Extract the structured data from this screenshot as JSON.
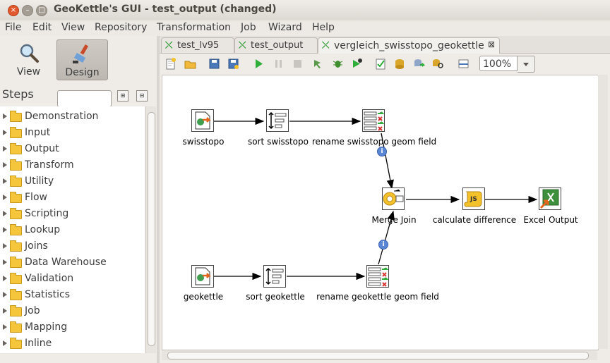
{
  "window": {
    "title": "GeoKettle's GUI - test_output (changed)",
    "controls": [
      "close",
      "minimize",
      "maximize"
    ]
  },
  "menu": [
    "File",
    "Edit",
    "View",
    "Repository",
    "Transformation",
    "Job",
    "Wizard",
    "Help"
  ],
  "perspectives": [
    {
      "label": "View",
      "icon": "magnifier-icon",
      "active": false
    },
    {
      "label": "Design",
      "icon": "paintbrush-icon",
      "active": true
    }
  ],
  "steps_panel": {
    "title": "Steps",
    "search_placeholder": "",
    "items": [
      "Demonstration",
      "Input",
      "Output",
      "Transform",
      "Utility",
      "Flow",
      "Scripting",
      "Lookup",
      "Joins",
      "Data Warehouse",
      "Validation",
      "Statistics",
      "Job",
      "Mapping",
      "Inline"
    ]
  },
  "tabs": [
    {
      "label": "test_lv95",
      "active": false
    },
    {
      "label": "test_output",
      "active": false
    },
    {
      "label": "vergleich_swisstopo_geokettle",
      "active": true,
      "closable": true
    }
  ],
  "toolbar": {
    "zoom": "100%",
    "icons": [
      "new-icon",
      "open-icon",
      "save-icon",
      "save-as-icon",
      "run-icon",
      "pause-icon",
      "stop-icon",
      "preview-icon",
      "debug-icon",
      "replay-icon",
      "verify-icon",
      "impact-icon",
      "sql-icon",
      "explore-db-icon",
      "show-results-icon"
    ]
  },
  "canvas": {
    "steps": [
      {
        "id": "swisstopo",
        "label": "swisstopo",
        "type": "input"
      },
      {
        "id": "sort_swisstopo",
        "label": "sort swisstopo",
        "type": "sort"
      },
      {
        "id": "rename_swisstopo",
        "label": "rename swisstopo geom field",
        "type": "select"
      },
      {
        "id": "merge_join",
        "label": "Merge Join",
        "type": "join"
      },
      {
        "id": "calc_diff",
        "label": "calculate difference",
        "type": "script"
      },
      {
        "id": "excel_out",
        "label": "Excel Output",
        "type": "excel"
      },
      {
        "id": "geokettle",
        "label": "geokettle",
        "type": "input"
      },
      {
        "id": "sort_geokettle",
        "label": "sort geokettle",
        "type": "sort"
      },
      {
        "id": "rename_geokettle",
        "label": "rename geokettle geom field",
        "type": "select"
      }
    ],
    "hops": [
      [
        "swisstopo",
        "sort_swisstopo"
      ],
      [
        "sort_swisstopo",
        "rename_swisstopo"
      ],
      [
        "rename_swisstopo",
        "merge_join"
      ],
      [
        "merge_join",
        "calc_diff"
      ],
      [
        "calc_diff",
        "excel_out"
      ],
      [
        "geokettle",
        "sort_geokettle"
      ],
      [
        "sort_geokettle",
        "rename_geokettle"
      ],
      [
        "rename_geokettle",
        "merge_join"
      ]
    ],
    "hop_info_icon": "i"
  }
}
